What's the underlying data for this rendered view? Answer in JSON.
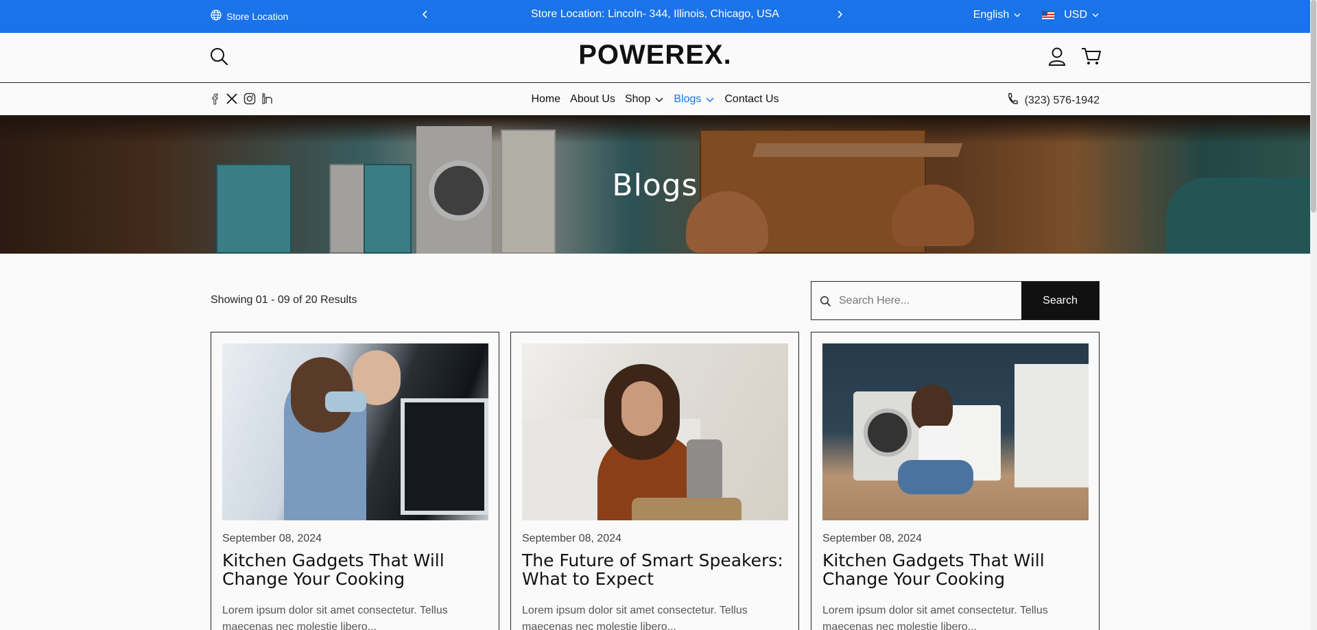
{
  "topbar": {
    "store_label": "Store Location",
    "announcement": "Store Location: Lincoln- 344, Illinois, Chicago, USA",
    "language": "English",
    "currency": "USD",
    "bg_color": "#1a73e8"
  },
  "header": {
    "logo": "POWEREX.",
    "icons": [
      "search-icon",
      "user-icon",
      "cart-icon"
    ]
  },
  "nav": {
    "social": [
      "facebook-icon",
      "x-icon",
      "instagram-icon",
      "linkedin-icon"
    ],
    "items": [
      {
        "label": "Home"
      },
      {
        "label": "About Us"
      },
      {
        "label": "Shop"
      },
      {
        "label": "Blogs"
      },
      {
        "label": "Contact Us"
      }
    ],
    "phone": "(323) 576-1942"
  },
  "hero": {
    "title": "Blogs"
  },
  "results": {
    "showing": "Showing 01 - 09 of 20 Results",
    "search_placeholder": "Search Here...",
    "search_button": "Search"
  },
  "posts": [
    {
      "date": "September 08, 2024",
      "title": "Kitchen Gadgets That Will Change Your Cooking",
      "excerpt": "Lorem ipsum dolor sit amet consectetur. Tellus maecenas nec molestie libero..."
    },
    {
      "date": "September 08, 2024",
      "title": "The Future of Smart Speakers: What to Expect",
      "excerpt": "Lorem ipsum dolor sit amet consectetur. Tellus maecenas nec molestie libero..."
    },
    {
      "date": "September 08, 2024",
      "title": "Kitchen Gadgets That Will Change Your Cooking",
      "excerpt": "Lorem ipsum dolor sit amet consectetur. Tellus maecenas nec molestie libero..."
    }
  ]
}
